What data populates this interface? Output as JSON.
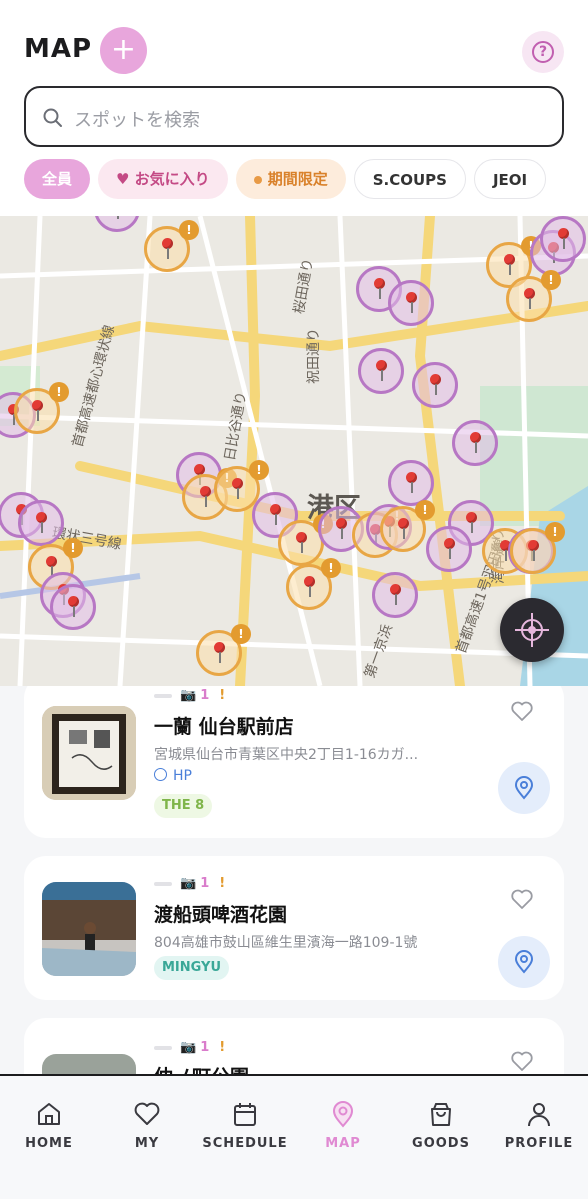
{
  "header": {
    "title": "MAP",
    "add_label": "+",
    "help_label": "?"
  },
  "search": {
    "placeholder": "スポットを検索"
  },
  "filters": [
    {
      "label": "全員"
    },
    {
      "label": "お気に入り"
    },
    {
      "label": "期間限定"
    },
    {
      "label": "S.COUPS"
    },
    {
      "label": "JEOI"
    }
  ],
  "map": {
    "ward_label": "港区",
    "road_labels": [
      "桜田通り",
      "首都高速都心環状線",
      "祝田通り",
      "日比谷通り",
      "環状三号線",
      "第一京浜",
      "首都高速1号羽田線",
      "海岸通り",
      "桜田通り"
    ],
    "colors": {
      "purple_pin": "#b777c4",
      "orange_pin": "#e8a645",
      "warning": "#e39b2f"
    }
  },
  "spots": [
    {
      "camera_icon": "📷",
      "photo_count": "1",
      "alert": "!",
      "name": "一蘭 仙台駅前店",
      "address": "宮城県仙台市青葉区中央2丁目1-16カガ...",
      "hp_label": "HP",
      "member": "THE 8"
    },
    {
      "camera_icon": "📷",
      "photo_count": "1",
      "alert": "!",
      "name": "渡船頭啤酒花園",
      "address": "804高雄市鼓山區維生里濱海一路109-1號",
      "member": "MINGYU"
    },
    {
      "camera_icon": "📷",
      "photo_count": "1",
      "alert": "!",
      "name": "仲ノ町公園"
    }
  ],
  "nav": [
    {
      "label": "HOME",
      "icon": "home-icon"
    },
    {
      "label": "MY",
      "icon": "heart-icon"
    },
    {
      "label": "SCHEDULE",
      "icon": "calendar-icon"
    },
    {
      "label": "MAP",
      "icon": "map-pin-icon",
      "active": true
    },
    {
      "label": "GOODS",
      "icon": "bag-icon"
    },
    {
      "label": "PROFILE",
      "icon": "person-icon"
    }
  ]
}
